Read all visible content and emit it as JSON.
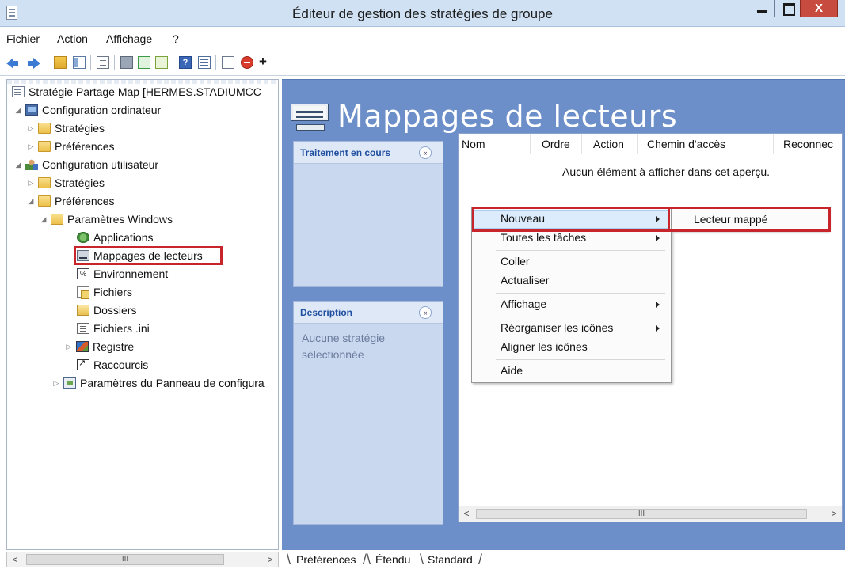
{
  "window": {
    "title": "Éditeur de gestion des stratégies de groupe",
    "close_label": "X"
  },
  "menu": [
    "Fichier",
    "Action",
    "Affichage",
    "?"
  ],
  "tree": {
    "nodes": [
      {
        "label": "Stratégie Partage Map [HERMES.STADIUMCC",
        "icon": "policy-icon",
        "toggle": ""
      },
      {
        "label": "Configuration ordinateur",
        "icon": "computer-icon",
        "toggle": "◢"
      },
      {
        "label": "Stratégies",
        "icon": "folder-icon",
        "toggle": "▷"
      },
      {
        "label": "Préférences",
        "icon": "folder-icon",
        "toggle": "▷"
      },
      {
        "label": "Configuration utilisateur",
        "icon": "user-icon",
        "toggle": "◢"
      },
      {
        "label": "Stratégies",
        "icon": "folder-icon",
        "toggle": "▷"
      },
      {
        "label": "Préférences",
        "icon": "folder-icon",
        "toggle": "◢"
      },
      {
        "label": "Paramètres Windows",
        "icon": "folder-icon",
        "toggle": "◢"
      },
      {
        "label": "Applications",
        "icon": "applications-icon",
        "toggle": ""
      },
      {
        "label": "Mappages de lecteurs",
        "icon": "drive-map-icon",
        "toggle": ""
      },
      {
        "label": "Environnement",
        "icon": "environment-icon",
        "toggle": ""
      },
      {
        "label": "Fichiers",
        "icon": "files-icon",
        "toggle": ""
      },
      {
        "label": "Dossiers",
        "icon": "folders-icon",
        "toggle": ""
      },
      {
        "label": "Fichiers .ini",
        "icon": "ini-file-icon",
        "toggle": ""
      },
      {
        "label": "Registre",
        "icon": "registry-icon",
        "toggle": "▷"
      },
      {
        "label": "Raccourcis",
        "icon": "shortcut-icon",
        "toggle": ""
      },
      {
        "label": "Paramètres du Panneau de configura",
        "icon": "control-panel-icon",
        "toggle": "▷"
      }
    ],
    "env_glyph": "%",
    "scroll_thumb": "III"
  },
  "content": {
    "heading": "Mappages de lecteurs",
    "processing": {
      "title": "Traitement en cours"
    },
    "description": {
      "title": "Description",
      "text": "Aucune stratégie sélectionnée"
    },
    "collapse_glyph": "«",
    "columns": [
      "Nom",
      "Ordre",
      "Action",
      "Chemin d'accès",
      "Reconnec"
    ],
    "empty_message": "Aucun élément à afficher dans cet aperçu.",
    "scroll_thumb": "III"
  },
  "context_menu": {
    "items": [
      {
        "label": "Nouveau",
        "submenu": true
      },
      {
        "label": "Toutes les tâches",
        "submenu": true
      },
      {
        "label": "Coller",
        "submenu": false
      },
      {
        "label": "Actualiser",
        "submenu": false
      },
      {
        "label": "Affichage",
        "submenu": true
      },
      {
        "label": "Réorganiser les icônes",
        "submenu": true
      },
      {
        "label": "Aligner les icônes",
        "submenu": false
      },
      {
        "label": "Aide",
        "submenu": false
      }
    ],
    "submenu_item": "Lecteur mappé"
  },
  "tabs": [
    "Préférences",
    "Étendu",
    "Standard"
  ],
  "colors": {
    "panel_blue": "#6c8ec9",
    "highlight_red": "#c8242c",
    "title_bar": "#cfe1f3"
  }
}
